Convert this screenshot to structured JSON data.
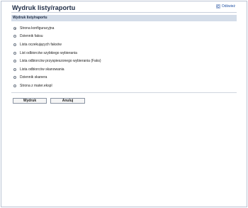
{
  "header": {
    "title": "Wydruk listy/raportu",
    "refresh_label": "Odśwież",
    "refresh_icon": "refresh-icon"
  },
  "section": {
    "title": "Wydruk listy/raportu"
  },
  "options": [
    {
      "label": "Strona konfiguracyjna",
      "checked": true
    },
    {
      "label": "Dziennik faksu",
      "checked": false
    },
    {
      "label": "Lista oczekujących faksów",
      "checked": false
    },
    {
      "label": "List odbiorców szybkiego wybierania",
      "checked": false
    },
    {
      "label": "Lista odbiorców przyspieszonego wybierania (Faks)",
      "checked": false
    },
    {
      "label": "Lista odbiorców skanowania",
      "checked": false
    },
    {
      "label": "Dziennik skanera",
      "checked": false
    },
    {
      "label": "Strona z mater.ekspl",
      "checked": false
    }
  ],
  "buttons": {
    "print_label": "Wydruk",
    "cancel_label": "Anuluj"
  }
}
